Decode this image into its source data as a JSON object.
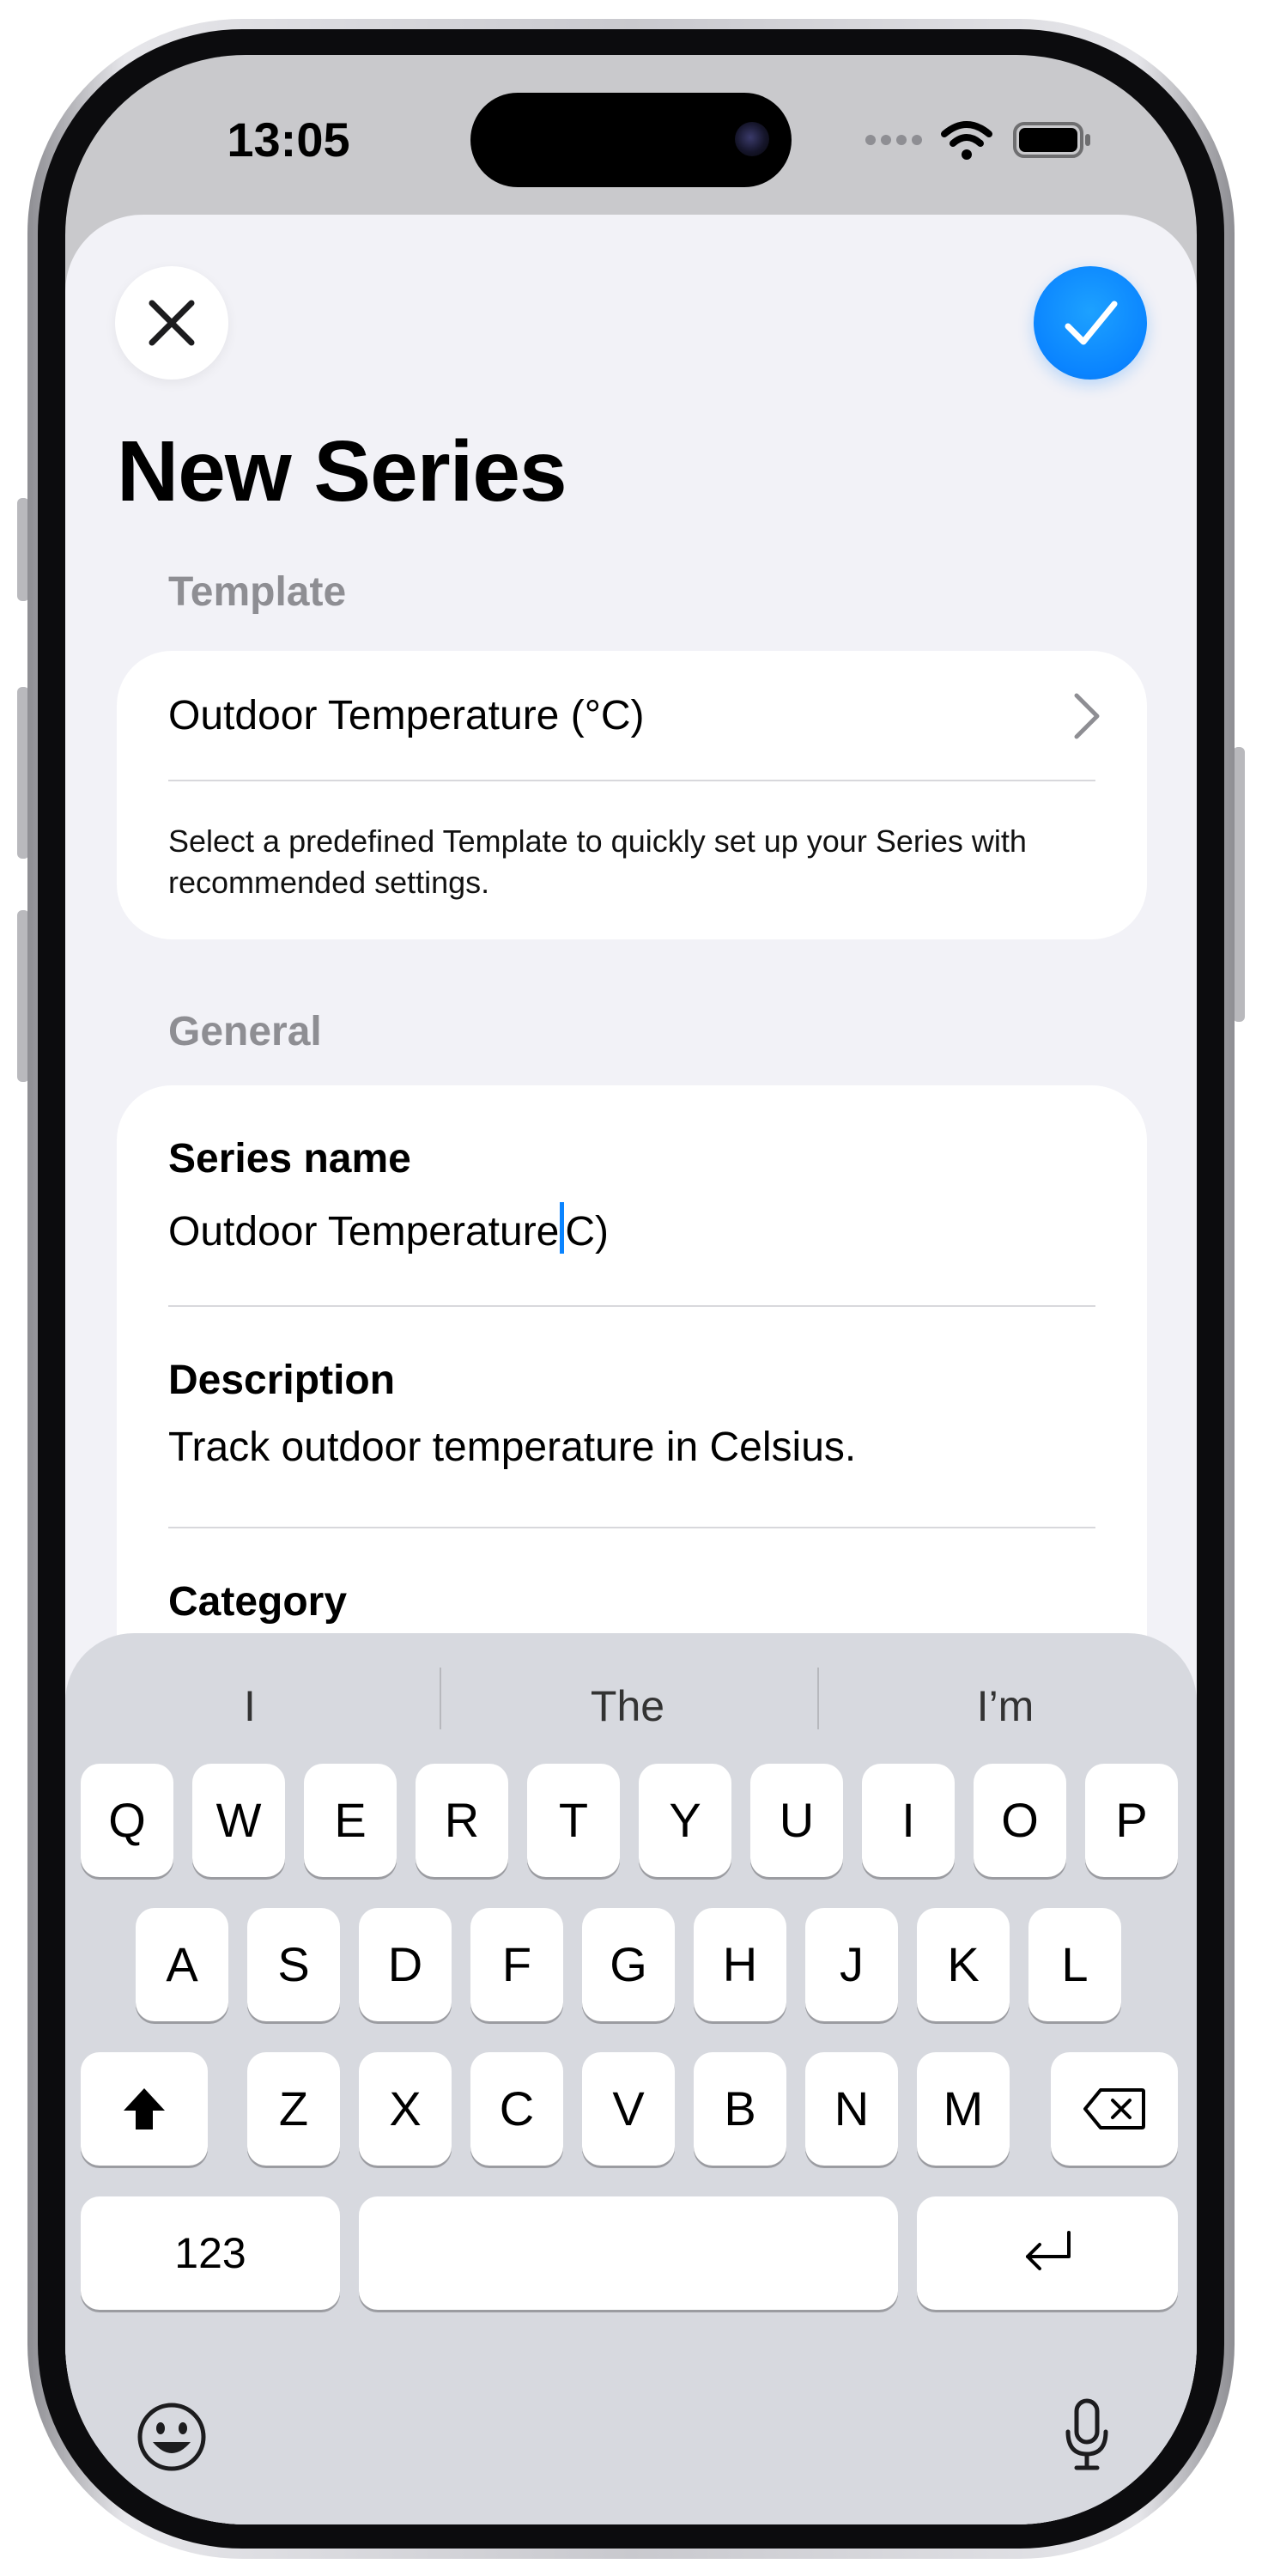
{
  "status_bar": {
    "time": "13:05"
  },
  "header": {
    "title": "New Series"
  },
  "template_section": {
    "label": "Template",
    "selected": "Outdoor Temperature (°C)",
    "footnote": "Select a predefined Template to quickly set up your Series with recommended settings."
  },
  "general_section": {
    "label": "General",
    "series_name": {
      "label": "Series name",
      "value_before_caret": "Outdoor Temperature",
      "value_after_caret": "C)"
    },
    "description": {
      "label": "Description",
      "value": "Track outdoor temperature in Celsius."
    },
    "category": {
      "label": "Category"
    }
  },
  "keyboard": {
    "suggestions": [
      "I",
      "The",
      "I’m"
    ],
    "row1": [
      "Q",
      "W",
      "E",
      "R",
      "T",
      "Y",
      "U",
      "I",
      "O",
      "P"
    ],
    "row2": [
      "A",
      "S",
      "D",
      "F",
      "G",
      "H",
      "J",
      "K",
      "L"
    ],
    "row3": [
      "Z",
      "X",
      "C",
      "V",
      "B",
      "N",
      "M"
    ],
    "numbers_label": "123"
  },
  "icons": {
    "close": "close-icon",
    "confirm": "checkmark-icon",
    "chevron": "chevron-right-icon",
    "shift": "shift-icon",
    "delete": "delete-backward-icon",
    "return": "return-icon",
    "emoji": "emoji-icon",
    "mic": "microphone-icon"
  },
  "colors": {
    "accent": "#0a84ff",
    "background": "#f2f2f7",
    "secondary_text": "#8e8e93"
  }
}
